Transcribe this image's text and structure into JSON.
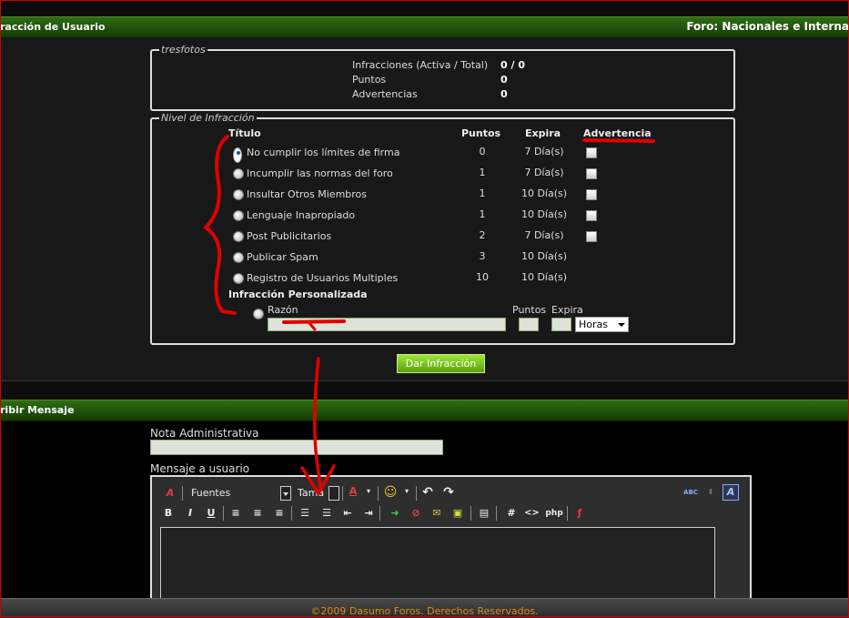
{
  "header1": {
    "left_title": "racción de Usuario",
    "right_title": "Foro: Nacionales e Interna"
  },
  "user_box": {
    "legend": "tresfotos",
    "stats": [
      {
        "label": "Infracciones (Activa / Total)",
        "value": "0 / 0"
      },
      {
        "label": "Puntos",
        "value": "0"
      },
      {
        "label": "Advertencias",
        "value": "0"
      }
    ]
  },
  "level_box": {
    "legend": "Nivel de Infracción",
    "col_titulo": "Título",
    "col_puntos": "Puntos",
    "col_expira": "Expira",
    "col_advertencia": "Advertencia",
    "rows": [
      {
        "title": "No cumplir los límites de firma",
        "points": "0",
        "expires": "7 Día(s)",
        "warn": true,
        "selected": true
      },
      {
        "title": "Incumplir las normas del foro",
        "points": "1",
        "expires": "7 Día(s)",
        "warn": true,
        "selected": false
      },
      {
        "title": "Insultar Otros Miembros",
        "points": "1",
        "expires": "10 Día(s)",
        "warn": true,
        "selected": false
      },
      {
        "title": "Lenguaje Inapropiado",
        "points": "1",
        "expires": "10 Día(s)",
        "warn": true,
        "selected": false
      },
      {
        "title": "Post Publicitarios",
        "points": "2",
        "expires": "7 Día(s)",
        "warn": true,
        "selected": false
      },
      {
        "title": "Publicar Spam",
        "points": "3",
        "expires": "10 Día(s)",
        "warn": false,
        "selected": false
      },
      {
        "title": "Registro de Usuarios Multiples",
        "points": "10",
        "expires": "10 Día(s)",
        "warn": false,
        "selected": false
      }
    ],
    "custom_heading": "Infracción Personalizada",
    "custom_reason_label": "Razón",
    "custom_points_label": "Puntos",
    "custom_expire_label": "Expira",
    "custom_unit": "Horas"
  },
  "submit_button": "Dar Infracción",
  "header2": {
    "left_title": "ribir Mensaje"
  },
  "admin_note_label": "Nota Administrativa",
  "message_label": "Mensaje a usuario",
  "editor_toolbar": {
    "font_select": "Fuentes",
    "size_select": "Tama",
    "bold": "B",
    "italic": "I",
    "underline": "U",
    "php": "php",
    "hash": "#",
    "code": "<>",
    "spell": "ABC"
  },
  "footer_text": "©2009 Dasumo Foros. Derechos Reservados.",
  "colors": {
    "band_green": "#2e6d12",
    "button_green": "#7cc52a",
    "annotation_red": "#e00000",
    "footer_orange": "#e08a1a"
  }
}
